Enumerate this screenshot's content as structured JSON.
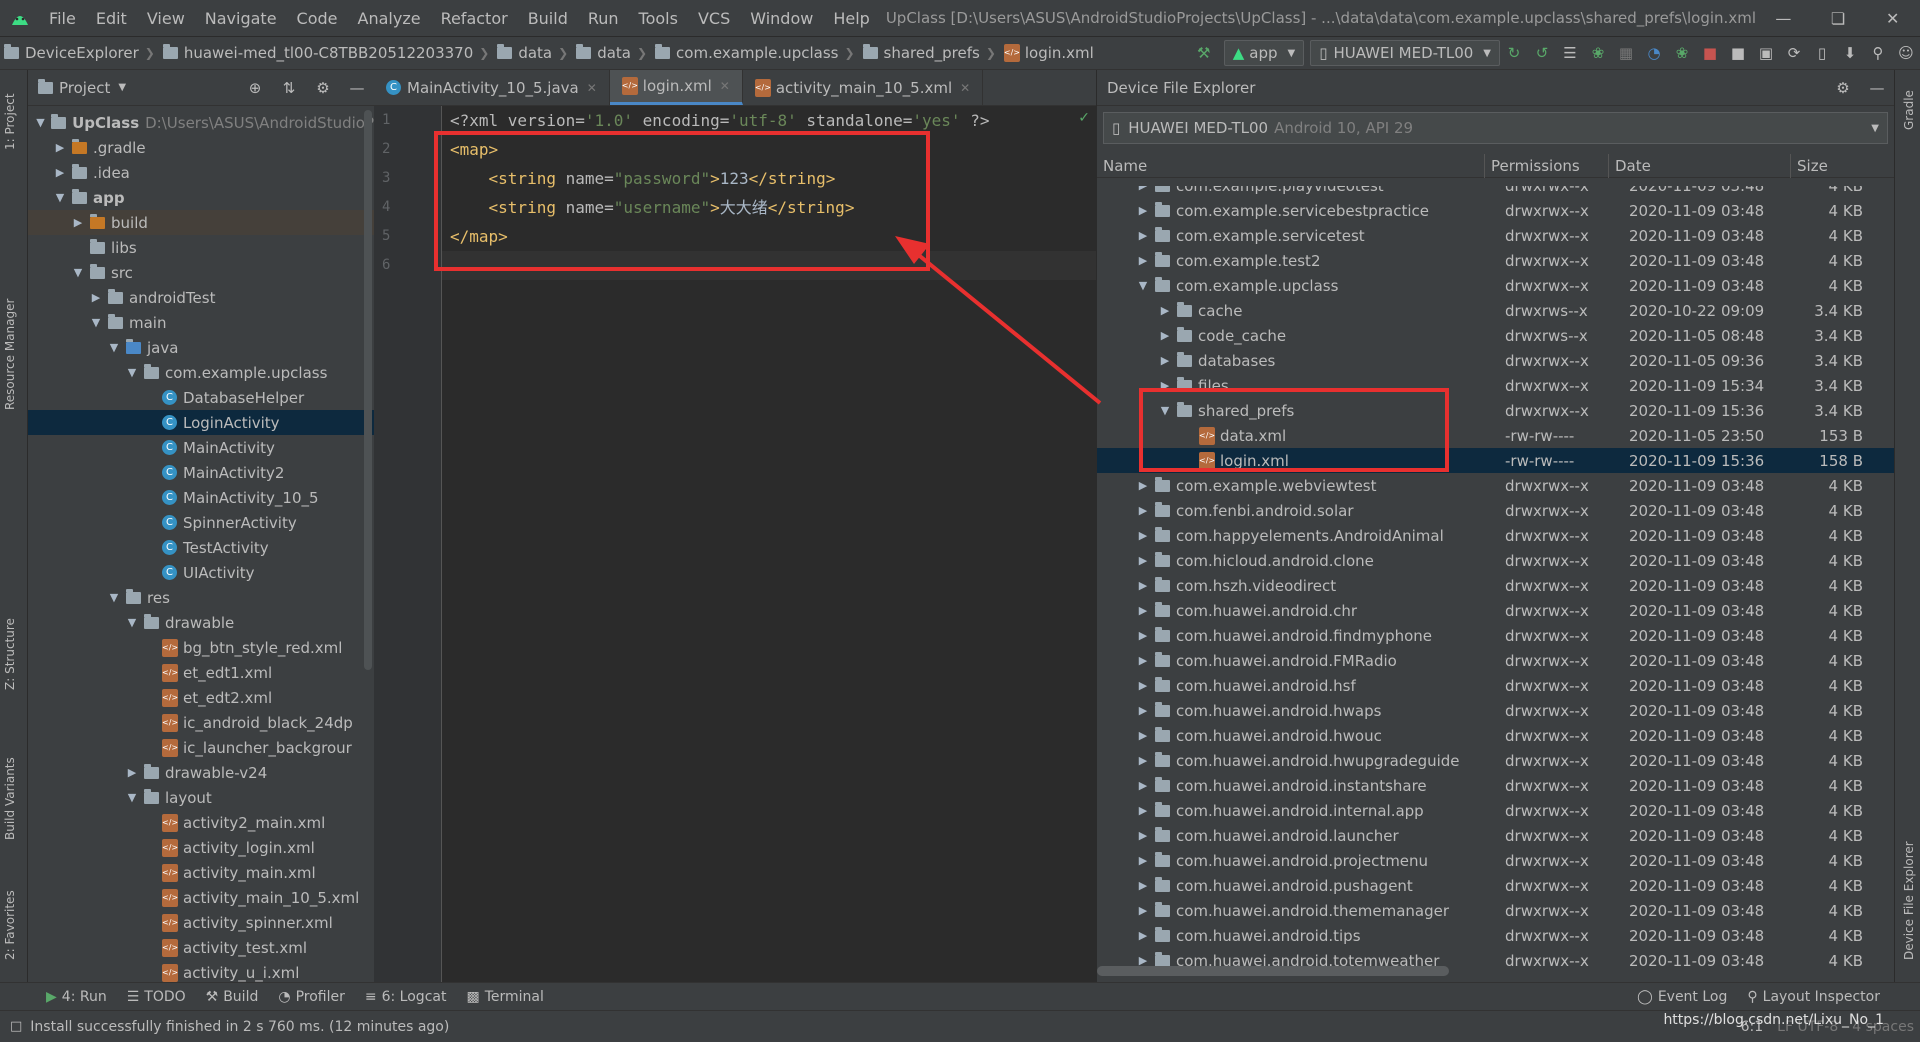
{
  "menubar": {
    "items": [
      "File",
      "Edit",
      "View",
      "Navigate",
      "Code",
      "Analyze",
      "Refactor",
      "Build",
      "Run",
      "Tools",
      "VCS",
      "Window",
      "Help"
    ],
    "title": "UpClass [D:\\Users\\ASUS\\AndroidStudioProjects\\UpClass] - ...\\data\\data\\com.example.upclass\\shared_prefs\\login.xml"
  },
  "breadcrumb": [
    "DeviceExplorer",
    "huawei-med_tl00-C8TBB20512203370",
    "data",
    "data",
    "com.example.upclass",
    "shared_prefs",
    "login.xml"
  ],
  "toolbar": {
    "config": "app",
    "device": "HUAWEI MED-TL00"
  },
  "left_strip": [
    "1: Project",
    "Resource Manager",
    "Z: Structure",
    "Build Variants",
    "2: Favorites"
  ],
  "right_strip": [
    "Gradle",
    "Device File Explorer"
  ],
  "project": {
    "header": "Project",
    "tree": [
      {
        "label": "UpClass",
        "extra": "D:\\Users\\ASUS\\AndroidStudioP",
        "indent": 0,
        "arrow": "down",
        "icon": "folder",
        "bold": true
      },
      {
        "label": ".gradle",
        "indent": 1,
        "arrow": "right",
        "icon": "folder-orange"
      },
      {
        "label": ".idea",
        "indent": 1,
        "arrow": "right",
        "icon": "folder"
      },
      {
        "label": "app",
        "indent": 1,
        "arrow": "down",
        "icon": "folder",
        "bold": true
      },
      {
        "label": "build",
        "indent": 2,
        "arrow": "right",
        "icon": "folder-orange",
        "dir": true
      },
      {
        "label": "libs",
        "indent": 2,
        "arrow": "",
        "icon": "folder"
      },
      {
        "label": "src",
        "indent": 2,
        "arrow": "down",
        "icon": "folder"
      },
      {
        "label": "androidTest",
        "indent": 3,
        "arrow": "right",
        "icon": "folder"
      },
      {
        "label": "main",
        "indent": 3,
        "arrow": "down",
        "icon": "folder"
      },
      {
        "label": "java",
        "indent": 4,
        "arrow": "down",
        "icon": "folder-blue"
      },
      {
        "label": "com.example.upclass",
        "indent": 5,
        "arrow": "down",
        "icon": "folder"
      },
      {
        "label": "DatabaseHelper",
        "indent": 6,
        "arrow": "",
        "icon": "class"
      },
      {
        "label": "LoginActivity",
        "indent": 6,
        "arrow": "",
        "icon": "class",
        "selected": true
      },
      {
        "label": "MainActivity",
        "indent": 6,
        "arrow": "",
        "icon": "class"
      },
      {
        "label": "MainActivity2",
        "indent": 6,
        "arrow": "",
        "icon": "class"
      },
      {
        "label": "MainActivity_10_5",
        "indent": 6,
        "arrow": "",
        "icon": "class"
      },
      {
        "label": "SpinnerActivity",
        "indent": 6,
        "arrow": "",
        "icon": "class"
      },
      {
        "label": "TestActivity",
        "indent": 6,
        "arrow": "",
        "icon": "class"
      },
      {
        "label": "UIActivity",
        "indent": 6,
        "arrow": "",
        "icon": "class"
      },
      {
        "label": "res",
        "indent": 4,
        "arrow": "down",
        "icon": "folder"
      },
      {
        "label": "drawable",
        "indent": 5,
        "arrow": "down",
        "icon": "folder"
      },
      {
        "label": "bg_btn_style_red.xml",
        "indent": 6,
        "arrow": "",
        "icon": "xml"
      },
      {
        "label": "et_edt1.xml",
        "indent": 6,
        "arrow": "",
        "icon": "xml"
      },
      {
        "label": "et_edt2.xml",
        "indent": 6,
        "arrow": "",
        "icon": "xml"
      },
      {
        "label": "ic_android_black_24dp",
        "indent": 6,
        "arrow": "",
        "icon": "xml"
      },
      {
        "label": "ic_launcher_backgrour",
        "indent": 6,
        "arrow": "",
        "icon": "xml"
      },
      {
        "label": "drawable-v24",
        "indent": 5,
        "arrow": "right",
        "icon": "folder"
      },
      {
        "label": "layout",
        "indent": 5,
        "arrow": "down",
        "icon": "folder"
      },
      {
        "label": "activity2_main.xml",
        "indent": 6,
        "arrow": "",
        "icon": "xml"
      },
      {
        "label": "activity_login.xml",
        "indent": 6,
        "arrow": "",
        "icon": "xml"
      },
      {
        "label": "activity_main.xml",
        "indent": 6,
        "arrow": "",
        "icon": "xml"
      },
      {
        "label": "activity_main_10_5.xml",
        "indent": 6,
        "arrow": "",
        "icon": "xml"
      },
      {
        "label": "activity_spinner.xml",
        "indent": 6,
        "arrow": "",
        "icon": "xml"
      },
      {
        "label": "activity_test.xml",
        "indent": 6,
        "arrow": "",
        "icon": "xml"
      },
      {
        "label": "activity_u_i.xml",
        "indent": 6,
        "arrow": "",
        "icon": "xml"
      }
    ]
  },
  "editor": {
    "tabs": [
      {
        "label": "MainActivity_10_5.java",
        "icon": "class",
        "active": false
      },
      {
        "label": "login.xml",
        "icon": "xml",
        "active": true
      },
      {
        "label": "activity_main_10_5.xml",
        "icon": "xml",
        "active": false
      }
    ],
    "line_numbers": [
      "1",
      "2",
      "3",
      "4",
      "5",
      "6"
    ],
    "lines": [
      [
        {
          "t": "<?xml ",
          "c": "pi"
        },
        {
          "t": "version=",
          "c": "att"
        },
        {
          "t": "'1.0'",
          "c": "val"
        },
        {
          "t": " encoding=",
          "c": "att"
        },
        {
          "t": "'utf-8'",
          "c": "val"
        },
        {
          "t": " standalone=",
          "c": "att"
        },
        {
          "t": "'yes'",
          "c": "val"
        },
        {
          "t": " ?>",
          "c": "pi"
        }
      ],
      [
        {
          "t": "<map>",
          "c": "tag"
        }
      ],
      [
        {
          "t": "    <string ",
          "c": "tag"
        },
        {
          "t": "name=",
          "c": "att"
        },
        {
          "t": "\"password\"",
          "c": "val"
        },
        {
          "t": ">",
          "c": "tag"
        },
        {
          "t": "123",
          "c": "txt"
        },
        {
          "t": "</string>",
          "c": "tag"
        }
      ],
      [
        {
          "t": "    <string ",
          "c": "tag"
        },
        {
          "t": "name=",
          "c": "att"
        },
        {
          "t": "\"username\"",
          "c": "val"
        },
        {
          "t": ">",
          "c": "tag"
        },
        {
          "t": "大大绪",
          "c": "txt"
        },
        {
          "t": "</string>",
          "c": "tag"
        }
      ],
      [
        {
          "t": "</map>",
          "c": "tag"
        }
      ],
      []
    ]
  },
  "device_explorer": {
    "title": "Device File Explorer",
    "device": "HUAWEI MED-TL00",
    "device_info": "Android 10, API 29",
    "columns": [
      "Name",
      "Permissions",
      "Date",
      "Size"
    ],
    "rows": [
      {
        "name": "com.example.playvideotest",
        "perm": "drwxrwx--x",
        "date": "2020-11-09 03:48",
        "size": "4 KB",
        "indent": 0,
        "arrow": "right",
        "icon": "folder"
      },
      {
        "name": "com.example.servicebestpractice",
        "perm": "drwxrwx--x",
        "date": "2020-11-09 03:48",
        "size": "4 KB",
        "indent": 0,
        "arrow": "right",
        "icon": "folder"
      },
      {
        "name": "com.example.servicetest",
        "perm": "drwxrwx--x",
        "date": "2020-11-09 03:48",
        "size": "4 KB",
        "indent": 0,
        "arrow": "right",
        "icon": "folder"
      },
      {
        "name": "com.example.test2",
        "perm": "drwxrwx--x",
        "date": "2020-11-09 03:48",
        "size": "4 KB",
        "indent": 0,
        "arrow": "right",
        "icon": "folder"
      },
      {
        "name": "com.example.upclass",
        "perm": "drwxrwx--x",
        "date": "2020-11-09 03:48",
        "size": "4 KB",
        "indent": 0,
        "arrow": "down",
        "icon": "folder"
      },
      {
        "name": "cache",
        "perm": "drwxrws--x",
        "date": "2020-10-22 09:09",
        "size": "3.4 KB",
        "indent": 1,
        "arrow": "right",
        "icon": "folder"
      },
      {
        "name": "code_cache",
        "perm": "drwxrws--x",
        "date": "2020-11-05 08:48",
        "size": "3.4 KB",
        "indent": 1,
        "arrow": "right",
        "icon": "folder"
      },
      {
        "name": "databases",
        "perm": "drwxrwx--x",
        "date": "2020-11-05 09:36",
        "size": "3.4 KB",
        "indent": 1,
        "arrow": "right",
        "icon": "folder"
      },
      {
        "name": "files",
        "perm": "drwxrwx--x",
        "date": "2020-11-09 15:34",
        "size": "3.4 KB",
        "indent": 1,
        "arrow": "right",
        "icon": "folder"
      },
      {
        "name": "shared_prefs",
        "perm": "drwxrwx--x",
        "date": "2020-11-09 15:36",
        "size": "3.4 KB",
        "indent": 1,
        "arrow": "down",
        "icon": "folder"
      },
      {
        "name": "data.xml",
        "perm": "-rw-rw----",
        "date": "2020-11-05 23:50",
        "size": "153 B",
        "indent": 2,
        "arrow": "",
        "icon": "xml"
      },
      {
        "name": "login.xml",
        "perm": "-rw-rw----",
        "date": "2020-11-09 15:36",
        "size": "158 B",
        "indent": 2,
        "arrow": "",
        "icon": "xml",
        "selected": true
      },
      {
        "name": "com.example.webviewtest",
        "perm": "drwxrwx--x",
        "date": "2020-11-09 03:48",
        "size": "4 KB",
        "indent": 0,
        "arrow": "right",
        "icon": "folder"
      },
      {
        "name": "com.fenbi.android.solar",
        "perm": "drwxrwx--x",
        "date": "2020-11-09 03:48",
        "size": "4 KB",
        "indent": 0,
        "arrow": "right",
        "icon": "folder"
      },
      {
        "name": "com.happyelements.AndroidAnimal",
        "perm": "drwxrwx--x",
        "date": "2020-11-09 03:48",
        "size": "4 KB",
        "indent": 0,
        "arrow": "right",
        "icon": "folder"
      },
      {
        "name": "com.hicloud.android.clone",
        "perm": "drwxrwx--x",
        "date": "2020-11-09 03:48",
        "size": "4 KB",
        "indent": 0,
        "arrow": "right",
        "icon": "folder"
      },
      {
        "name": "com.hszh.videodirect",
        "perm": "drwxrwx--x",
        "date": "2020-11-09 03:48",
        "size": "4 KB",
        "indent": 0,
        "arrow": "right",
        "icon": "folder"
      },
      {
        "name": "com.huawei.android.chr",
        "perm": "drwxrwx--x",
        "date": "2020-11-09 03:48",
        "size": "4 KB",
        "indent": 0,
        "arrow": "right",
        "icon": "folder"
      },
      {
        "name": "com.huawei.android.findmyphone",
        "perm": "drwxrwx--x",
        "date": "2020-11-09 03:48",
        "size": "4 KB",
        "indent": 0,
        "arrow": "right",
        "icon": "folder"
      },
      {
        "name": "com.huawei.android.FMRadio",
        "perm": "drwxrwx--x",
        "date": "2020-11-09 03:48",
        "size": "4 KB",
        "indent": 0,
        "arrow": "right",
        "icon": "folder"
      },
      {
        "name": "com.huawei.android.hsf",
        "perm": "drwxrwx--x",
        "date": "2020-11-09 03:48",
        "size": "4 KB",
        "indent": 0,
        "arrow": "right",
        "icon": "folder"
      },
      {
        "name": "com.huawei.android.hwaps",
        "perm": "drwxrwx--x",
        "date": "2020-11-09 03:48",
        "size": "4 KB",
        "indent": 0,
        "arrow": "right",
        "icon": "folder"
      },
      {
        "name": "com.huawei.android.hwouc",
        "perm": "drwxrwx--x",
        "date": "2020-11-09 03:48",
        "size": "4 KB",
        "indent": 0,
        "arrow": "right",
        "icon": "folder"
      },
      {
        "name": "com.huawei.android.hwupgradeguide",
        "perm": "drwxrwx--x",
        "date": "2020-11-09 03:48",
        "size": "4 KB",
        "indent": 0,
        "arrow": "right",
        "icon": "folder"
      },
      {
        "name": "com.huawei.android.instantshare",
        "perm": "drwxrwx--x",
        "date": "2020-11-09 03:48",
        "size": "4 KB",
        "indent": 0,
        "arrow": "right",
        "icon": "folder"
      },
      {
        "name": "com.huawei.android.internal.app",
        "perm": "drwxrwx--x",
        "date": "2020-11-09 03:48",
        "size": "4 KB",
        "indent": 0,
        "arrow": "right",
        "icon": "folder"
      },
      {
        "name": "com.huawei.android.launcher",
        "perm": "drwxrwx--x",
        "date": "2020-11-09 03:48",
        "size": "4 KB",
        "indent": 0,
        "arrow": "right",
        "icon": "folder"
      },
      {
        "name": "com.huawei.android.projectmenu",
        "perm": "drwxrwx--x",
        "date": "2020-11-09 03:48",
        "size": "4 KB",
        "indent": 0,
        "arrow": "right",
        "icon": "folder"
      },
      {
        "name": "com.huawei.android.pushagent",
        "perm": "drwxrwx--x",
        "date": "2020-11-09 03:48",
        "size": "4 KB",
        "indent": 0,
        "arrow": "right",
        "icon": "folder"
      },
      {
        "name": "com.huawei.android.thememanager",
        "perm": "drwxrwx--x",
        "date": "2020-11-09 03:48",
        "size": "4 KB",
        "indent": 0,
        "arrow": "right",
        "icon": "folder"
      },
      {
        "name": "com.huawei.android.tips",
        "perm": "drwxrwx--x",
        "date": "2020-11-09 03:48",
        "size": "4 KB",
        "indent": 0,
        "arrow": "right",
        "icon": "folder"
      },
      {
        "name": "com.huawei.android.totemweather",
        "perm": "drwxrwx--x",
        "date": "2020-11-09 03:48",
        "size": "4 KB",
        "indent": 0,
        "arrow": "right",
        "icon": "folder"
      }
    ]
  },
  "tool_windows": {
    "left": [
      "4: Run",
      "TODO",
      "Build",
      "Profiler",
      "6: Logcat",
      "Terminal"
    ],
    "right": [
      "Event Log",
      "Layout Inspector"
    ]
  },
  "status": {
    "message": "Install successfully finished in 2 s 760 ms. (12 minutes ago)",
    "position": "6:1",
    "encoding": "LF  UTF-8",
    "indent": "4 spaces",
    "watermark": "https://blog.csdn.net/Lixu_No_1"
  },
  "colors": {
    "highlight": "#e8302f",
    "selection": "#0d293e",
    "accent": "#4a88c7"
  }
}
